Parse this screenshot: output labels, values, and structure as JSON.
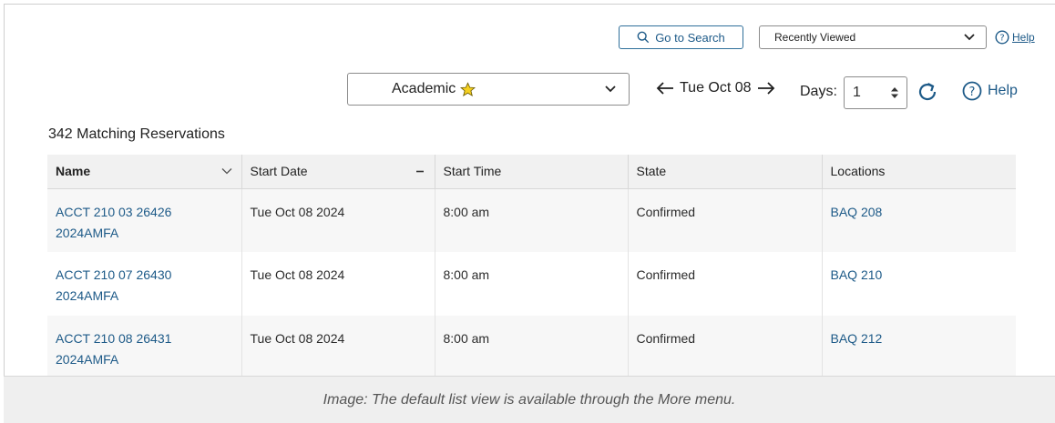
{
  "topbar": {
    "go_search_label": "Go to Search",
    "recently_viewed_label": "Recently Viewed",
    "help_label": "Help"
  },
  "controls": {
    "view_select_label": "Academic",
    "date_label": "Tue Oct 08",
    "days_label": "Days:",
    "days_value": "1",
    "help_label": "Help"
  },
  "results": {
    "count_text": "342 Matching Reservations"
  },
  "table": {
    "columns": [
      "Name",
      "Start Date",
      "Start Time",
      "State",
      "Locations"
    ],
    "rows": [
      {
        "name": "ACCT 210 03 26426 2024AMFA",
        "start_date": "Tue Oct 08 2024",
        "start_time": "8:00 am",
        "state": "Confirmed",
        "location": "BAQ 208"
      },
      {
        "name": "ACCT 210 07 26430 2024AMFA",
        "start_date": "Tue Oct 08 2024",
        "start_time": "8:00 am",
        "state": "Confirmed",
        "location": "BAQ 210"
      },
      {
        "name": "ACCT 210 08 26431 2024AMFA",
        "start_date": "Tue Oct 08 2024",
        "start_time": "8:00 am",
        "state": "Confirmed",
        "location": "BAQ 212"
      }
    ]
  },
  "caption": "Image: The default list view is available through the More menu.",
  "icons": {
    "search": "search-icon",
    "chevron": "chevron-down-icon",
    "help": "help-circle-icon",
    "star": "star-icon",
    "prev": "arrow-left-icon",
    "next": "arrow-right-icon",
    "stepper": "stepper-icon",
    "refresh": "refresh-icon",
    "sort": "sort-minus-icon"
  },
  "colors": {
    "accent": "#1d5a88",
    "header_bg": "#f1f1f1",
    "star": "#f5d020"
  }
}
